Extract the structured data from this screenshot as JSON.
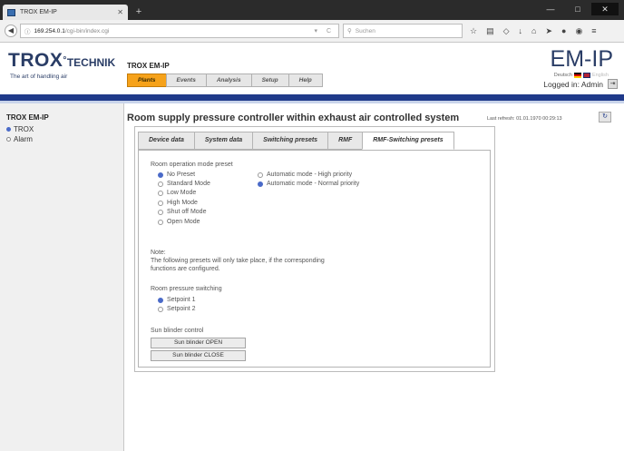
{
  "browser": {
    "tab_title": "TROX EM-IP",
    "url_host": "169.254.0.1",
    "url_path": "/cgi-bin/index.cgi",
    "search_placeholder": "Suchen"
  },
  "header": {
    "logo_main": "TROX",
    "logo_suffix": "TECHNIK",
    "logo_tagline": "The art of handling air",
    "app_title": "TROX EM-IP",
    "brand": "EM-IP",
    "lang_de": "Deutsch",
    "lang_en": "English",
    "logged_in": "Logged in: Admin",
    "menu": [
      "Plants",
      "Events",
      "Analysis",
      "Setup",
      "Help"
    ],
    "active_menu": "Plants"
  },
  "sidebar": {
    "title": "TROX EM-IP",
    "items": [
      {
        "label": "TROX",
        "selected": true
      },
      {
        "label": "Alarm",
        "selected": false
      }
    ]
  },
  "main": {
    "title": "Room supply pressure controller within exhaust air controlled system",
    "last_refresh": "Last refresh: 01.01.1970 00:29:13",
    "tabs": [
      "Device data",
      "System data",
      "Switching presets",
      "RMF",
      "RMF-Switching presets"
    ],
    "active_tab": "RMF-Switching presets",
    "operation_preset_label": "Room operation mode preset",
    "operation_presets": [
      {
        "label": "No Preset",
        "selected": true
      },
      {
        "label": "Standard Mode",
        "selected": false
      },
      {
        "label": "Low Mode",
        "selected": false
      },
      {
        "label": "High Mode",
        "selected": false
      },
      {
        "label": "Shut off Mode",
        "selected": false
      },
      {
        "label": "Open Mode",
        "selected": false
      }
    ],
    "priority_presets": [
      {
        "label": "Automatic mode - High priority",
        "selected": false
      },
      {
        "label": "Automatic mode - Normal priority",
        "selected": true
      }
    ],
    "note_label": "Note:",
    "note_text_1": "The following presets will only take place, if the corresponding",
    "note_text_2": "functions are configured.",
    "pressure_switching_label": "Room pressure switching",
    "pressure_options": [
      {
        "label": "Setpoint 1",
        "selected": true
      },
      {
        "label": "Setpoint 2",
        "selected": false
      }
    ],
    "sun_blinder_label": "Sun blinder control",
    "sun_open_button": "Sun blinder OPEN",
    "sun_close_button": "Sun blinder CLOSE"
  },
  "colors": {
    "accent_orange": "#f6a21a",
    "brand_navy": "#2a3d66",
    "header_bar": "#1f3a8a",
    "radio_selected": "#4a6ac8"
  }
}
